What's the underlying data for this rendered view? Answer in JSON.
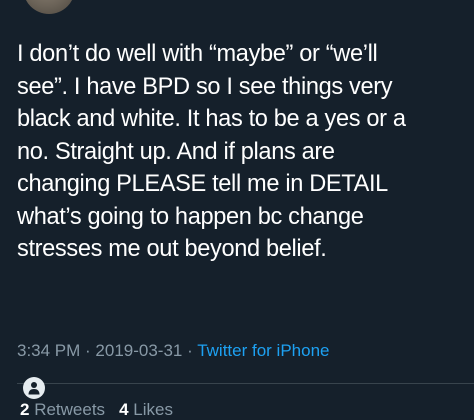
{
  "tweet": {
    "lines": [
      "I don’t do well with “maybe” or “we’ll",
      "see”. I have BPD so I see things very",
      "black and white. It has to be a yes or a",
      "no. Straight up. And if plans are",
      "changing PLEASE tell me in DETAIL",
      "what’s going to happen bc change",
      "stresses me out beyond belief."
    ]
  },
  "meta": {
    "time": "3:34 PM",
    "separator1": " · ",
    "date": "2019-03-31",
    "separator2": " · ",
    "source": "Twitter for iPhone"
  },
  "stats": {
    "retweets_count": "2",
    "retweets_label": " Retweets",
    "likes_count": "4",
    "likes_label": " Likes"
  },
  "icons": {
    "avatar": "user-avatar",
    "person": "person-icon"
  },
  "colors": {
    "background": "#15202b",
    "text": "#ffffff",
    "muted": "#8899a6",
    "link": "#1da1f2"
  }
}
